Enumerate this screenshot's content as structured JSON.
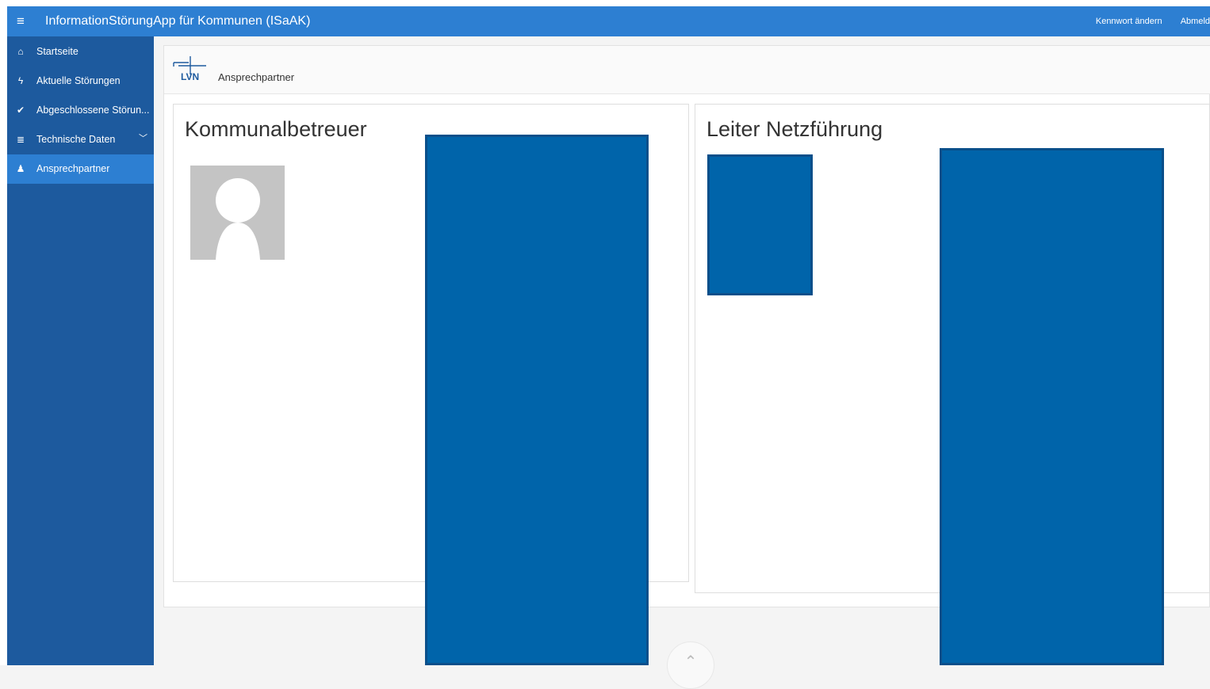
{
  "app": {
    "title": "InformationStörungApp für Kommunen (ISaAK)",
    "menu_icon": "hamburger-icon"
  },
  "top_nav": {
    "change_password": "Kennwort ändern",
    "logout": "Abmeld"
  },
  "sidebar": {
    "items": [
      {
        "label": "Startseite",
        "icon": "home-icon",
        "glyph": "⌂"
      },
      {
        "label": "Aktuelle Störungen",
        "icon": "lightning-icon",
        "glyph": "ϟ"
      },
      {
        "label": "Abgeschlossene Störun...",
        "icon": "check-icon",
        "glyph": "✔"
      },
      {
        "label": "Technische Daten",
        "icon": "database-icon",
        "glyph": "≣",
        "chevron": "﹀"
      },
      {
        "label": "Ansprechpartner",
        "icon": "person-icon",
        "glyph": "♟",
        "active": true
      }
    ]
  },
  "page": {
    "logo_text": "LVN",
    "breadcrumb": "Ansprechpartner"
  },
  "cards": {
    "left": {
      "title": "Kommunalbetreuer"
    },
    "right": {
      "title": "Leiter Netzführung"
    }
  },
  "colors": {
    "topbar": "#2d7fd2",
    "sidebar": "#1d5a9e",
    "active": "#2d7fd2",
    "redaction": "#0064aa"
  }
}
